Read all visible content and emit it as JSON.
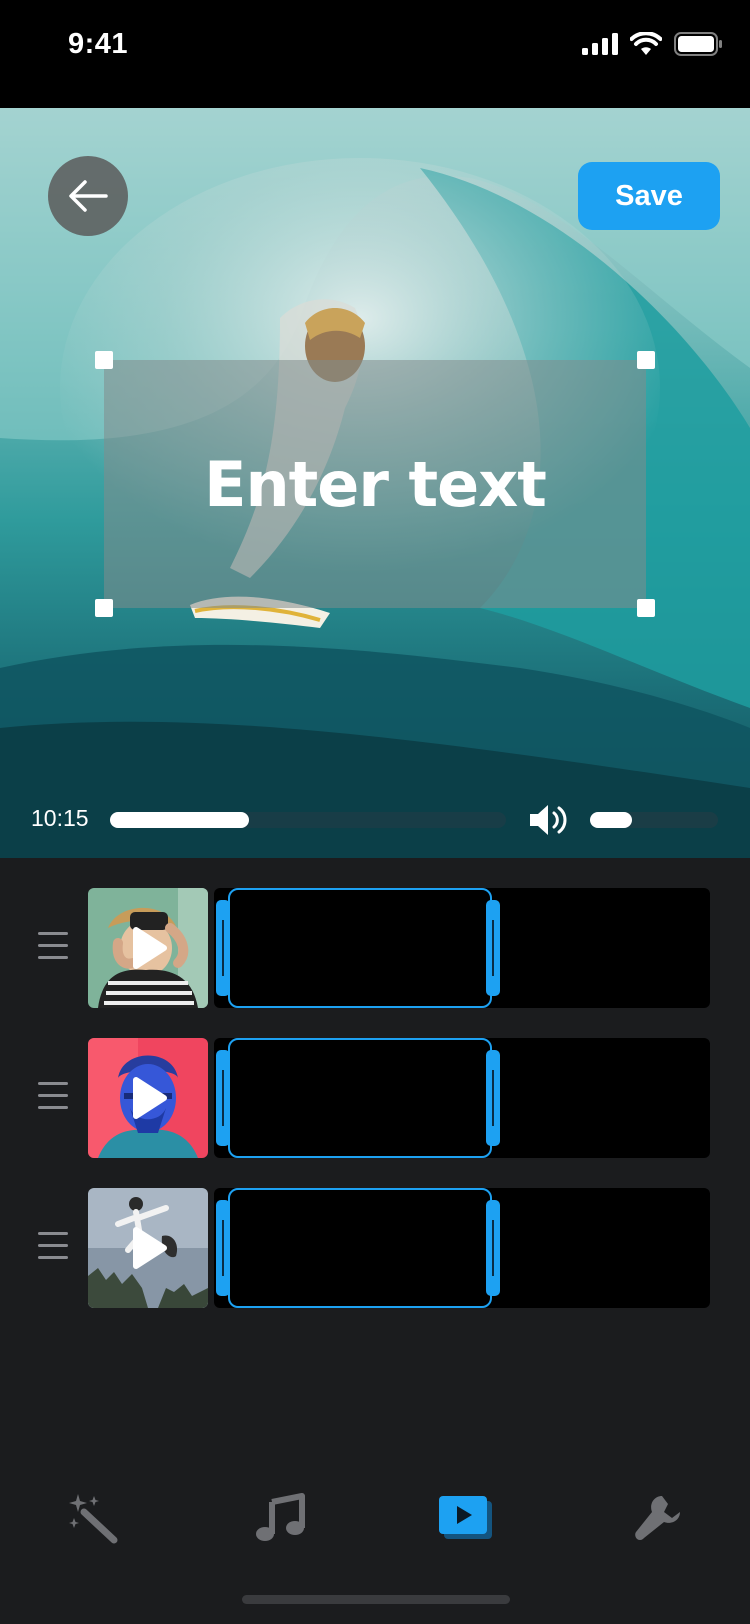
{
  "status_bar": {
    "time": "9:41"
  },
  "preview": {
    "save_label": "Save",
    "text_placeholder": "Enter text",
    "current_time": "10:15",
    "progress": 0.35,
    "volume": 0.33
  },
  "clips": [
    {
      "thumbnail": "person-with-camera-photo",
      "trim_start": 0.0,
      "trim_end": 0.53
    },
    {
      "thumbnail": "man-neon-portrait-photo",
      "trim_start": 0.0,
      "trim_end": 0.53
    },
    {
      "thumbnail": "skateboarder-jump-photo",
      "trim_start": 0.0,
      "trim_end": 0.53
    }
  ],
  "tabs": [
    {
      "name": "effects-tab",
      "icon": "magic-wand-icon"
    },
    {
      "name": "music-tab",
      "icon": "music-note-icon"
    },
    {
      "name": "clips-tab",
      "icon": "video-play-icon",
      "active": true
    },
    {
      "name": "tools-tab",
      "icon": "wrench-icon"
    }
  ],
  "colors": {
    "accent": "#1da1f2",
    "background": "#1b1c1e",
    "inactive_icon": "#6f7074"
  }
}
